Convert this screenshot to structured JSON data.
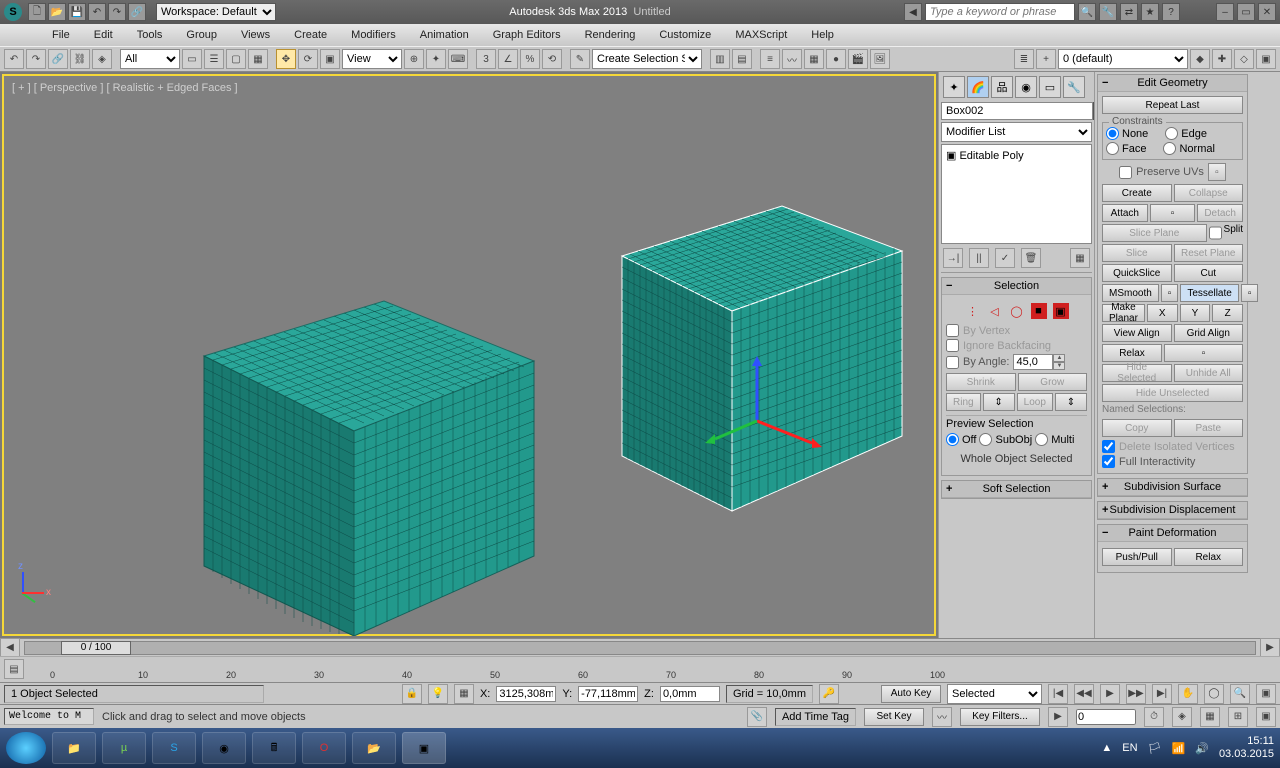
{
  "app": {
    "title": "Autodesk 3ds Max 2013",
    "document": "Untitled",
    "workspace_label": "Workspace: Default"
  },
  "search": {
    "placeholder": "Type a keyword or phrase"
  },
  "menu": [
    "File",
    "Edit",
    "Tools",
    "Group",
    "Views",
    "Create",
    "Modifiers",
    "Animation",
    "Graph Editors",
    "Rendering",
    "Customize",
    "MAXScript",
    "Help"
  ],
  "toolbar": {
    "filter_all": "All",
    "view_label": "View",
    "selection_set": "Create Selection Se",
    "layer": "0 (default)"
  },
  "viewport": {
    "label": "[ + ] [ Perspective ] [ Realistic + Edged Faces ]"
  },
  "object": {
    "name": "Box002"
  },
  "modifier_list_label": "Modifier List",
  "modifier_stack": [
    "Editable Poly"
  ],
  "rollups": {
    "selection": {
      "title": "Selection",
      "by_vertex": "By Vertex",
      "ignore_backfacing": "Ignore Backfacing",
      "by_angle": "By Angle:",
      "by_angle_val": "45,0",
      "shrink": "Shrink",
      "grow": "Grow",
      "ring": "Ring",
      "loop": "Loop",
      "preview": "Preview Selection",
      "off": "Off",
      "subobj": "SubObj",
      "multi": "Multi",
      "status": "Whole Object Selected"
    },
    "soft_selection": "Soft Selection",
    "edit_geometry": {
      "title": "Edit Geometry",
      "repeat_last": "Repeat Last",
      "constraints": "Constraints",
      "none": "None",
      "edge": "Edge",
      "face": "Face",
      "normal": "Normal",
      "preserve_uvs": "Preserve UVs",
      "create": "Create",
      "collapse": "Collapse",
      "attach": "Attach",
      "detach": "Detach",
      "slice_plane": "Slice Plane",
      "split": "Split",
      "slice": "Slice",
      "reset_plane": "Reset Plane",
      "quickslice": "QuickSlice",
      "cut": "Cut",
      "msmooth": "MSmooth",
      "tessellate": "Tessellate",
      "make_planar": "Make Planar",
      "x": "X",
      "y": "Y",
      "z": "Z",
      "view_align": "View Align",
      "grid_align": "Grid Align",
      "relax": "Relax",
      "hide_selected": "Hide Selected",
      "unhide_all": "Unhide All",
      "hide_unselected": "Hide Unselected",
      "named_selections": "Named Selections:",
      "copy": "Copy",
      "paste": "Paste",
      "delete_iso": "Delete Isolated Vertices",
      "full_interactivity": "Full Interactivity"
    },
    "subdiv_surface": "Subdivision Surface",
    "subdiv_displacement": "Subdivision Displacement",
    "paint_deform": "Paint Deformation",
    "pushpull": "Push/Pull",
    "relax2": "Relax"
  },
  "timeline": {
    "pos": "0 / 100",
    "ticks": [
      0,
      10,
      20,
      30,
      40,
      50,
      60,
      70,
      80,
      90,
      100
    ]
  },
  "status": {
    "selection": "1 Object Selected",
    "x": "3125,308m",
    "y": "-77,118mm",
    "z": "0,0mm",
    "grid": "Grid = 10,0mm",
    "add_time_tag": "Add Time Tag",
    "auto_key": "Auto Key",
    "set_key": "Set Key",
    "selected": "Selected",
    "key_filters": "Key Filters...",
    "frame": "0"
  },
  "prompt": {
    "welcome": "Welcome to M",
    "hint": "Click and drag to select and move objects"
  },
  "tray": {
    "lang": "EN",
    "time": "15:11",
    "date": "03.03.2015"
  }
}
